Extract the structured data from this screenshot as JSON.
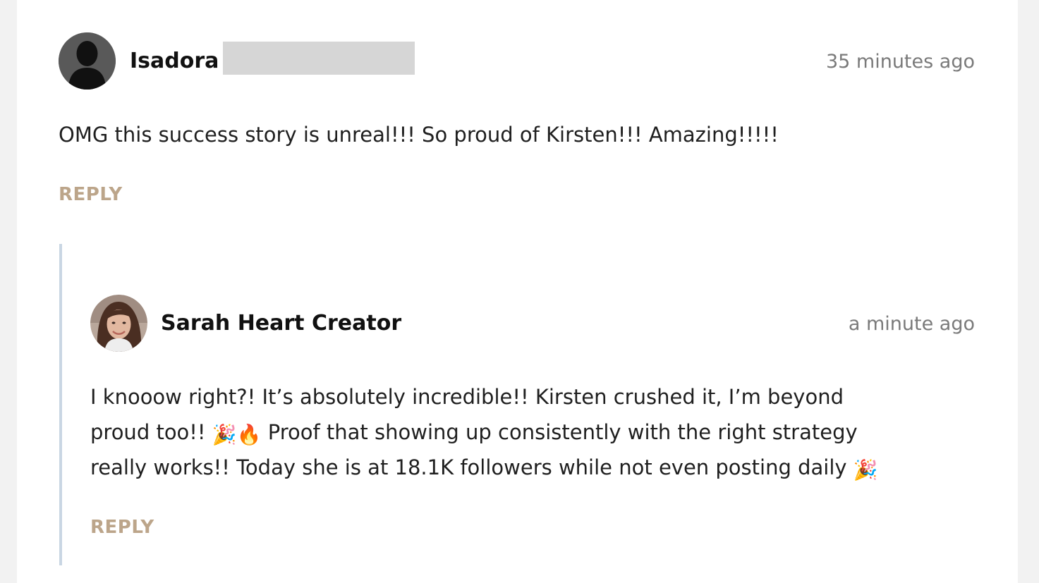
{
  "comments": [
    {
      "author": "Isadora",
      "time": "35 minutes ago",
      "text": "OMG this success story is unreal!!! So proud of Kirsten!!! Amazing!!!!!",
      "reply_label": "REPLY"
    }
  ],
  "reply": {
    "author": "Sarah Heart Creator",
    "time": "a minute ago",
    "line1": "I knooow right?! It’s absolutely incredible!! Kirsten crushed it, I’m beyond",
    "line2_start": "proud too!!",
    "line2_emoji": "🎉🔥",
    "line2_end": "Proof that showing up consistently with the right strategy",
    "line3_start": "really works!! Today she is at 18.1K followers while not even posting daily",
    "line3_emoji": "🎉",
    "reply_label": "REPLY"
  },
  "colors": {
    "accent": "#bca58a",
    "thread_line": "#c9d6e3",
    "redaction": "#d6d6d6"
  },
  "icons": {
    "default_avatar": "person-silhouette-icon",
    "user_avatar": "profile-photo"
  }
}
